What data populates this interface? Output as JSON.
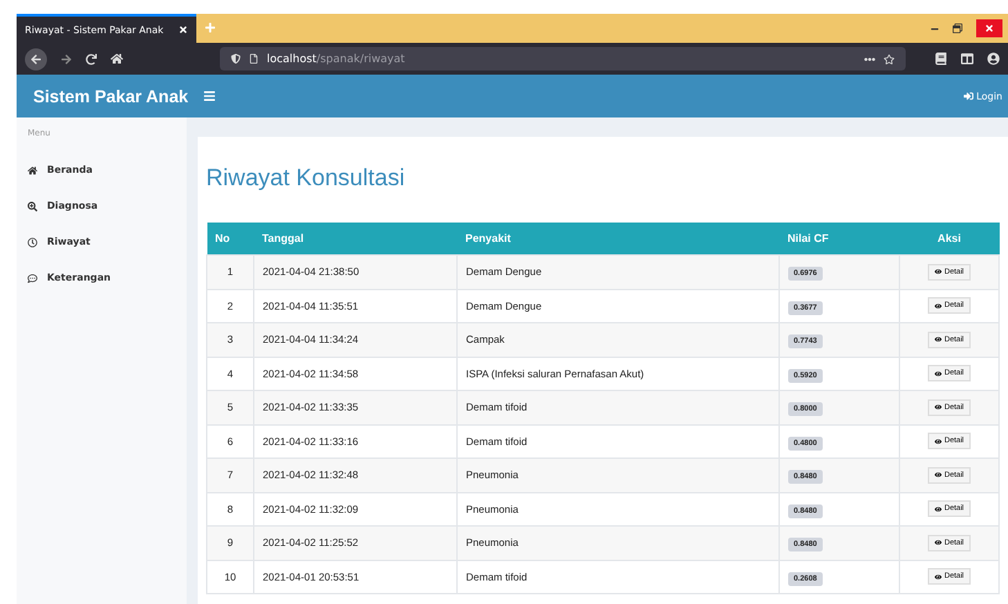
{
  "browser": {
    "tab_title": "Riwayat - Sistem Pakar Anak",
    "url_host": "localhost",
    "url_path": "/spanak/riwayat"
  },
  "header": {
    "brand": "Sistem Pakar Anak",
    "login": "Login"
  },
  "sidebar": {
    "heading": "Menu",
    "items": [
      {
        "label": "Beranda",
        "kind": "home"
      },
      {
        "label": "Diagnosa",
        "kind": "search"
      },
      {
        "label": "Riwayat",
        "kind": "history"
      },
      {
        "label": "Keterangan",
        "kind": "comment"
      }
    ]
  },
  "page_title": "Riwayat Konsultasi",
  "table": {
    "columns": [
      "No",
      "Tanggal",
      "Penyakit",
      "Nilai CF",
      "Aksi"
    ],
    "rows": [
      {
        "no": "1",
        "date": "2021-04-04 21:38:50",
        "disease": "Demam Dengue",
        "cf": "0.6976",
        "action": "Detail"
      },
      {
        "no": "2",
        "date": "2021-04-04 11:35:51",
        "disease": "Demam Dengue",
        "cf": "0.3677",
        "action": "Detail"
      },
      {
        "no": "3",
        "date": "2021-04-04 11:34:24",
        "disease": "Campak",
        "cf": "0.7743",
        "action": "Detail"
      },
      {
        "no": "4",
        "date": "2021-04-02 11:34:58",
        "disease": "ISPA (Infeksi saluran Pernafasan Akut)",
        "cf": "0.5920",
        "action": "Detail"
      },
      {
        "no": "5",
        "date": "2021-04-02 11:33:35",
        "disease": "Demam tifoid",
        "cf": "0.8000",
        "action": "Detail"
      },
      {
        "no": "6",
        "date": "2021-04-02 11:33:16",
        "disease": "Demam tifoid",
        "cf": "0.4800",
        "action": "Detail"
      },
      {
        "no": "7",
        "date": "2021-04-02 11:32:48",
        "disease": "Pneumonia",
        "cf": "0.8480",
        "action": "Detail"
      },
      {
        "no": "8",
        "date": "2021-04-02 11:32:09",
        "disease": "Pneumonia",
        "cf": "0.8480",
        "action": "Detail"
      },
      {
        "no": "9",
        "date": "2021-04-02 11:25:52",
        "disease": "Pneumonia",
        "cf": "0.8480",
        "action": "Detail"
      },
      {
        "no": "10",
        "date": "2021-04-01 20:53:51",
        "disease": "Demam tifoid",
        "cf": "0.2608",
        "action": "Detail"
      }
    ]
  }
}
